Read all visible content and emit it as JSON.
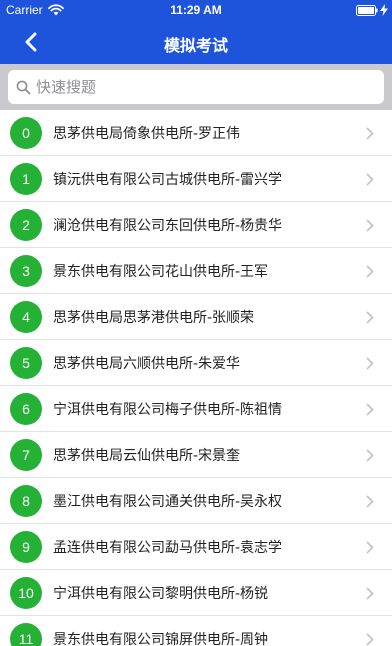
{
  "status_bar": {
    "carrier": "Carrier",
    "time": "11:29 AM"
  },
  "nav": {
    "title": "模拟考试",
    "back_icon": "chevron-left-icon"
  },
  "search": {
    "placeholder": "快速搜题",
    "value": ""
  },
  "colors": {
    "header": "#1e54dc",
    "badge": "#25b136",
    "search_bg": "#c9c9ce"
  },
  "items": [
    {
      "index": "0",
      "label": "思茅供电局倚象供电所-罗正伟"
    },
    {
      "index": "1",
      "label": "镇沅供电有限公司古城供电所-雷兴学"
    },
    {
      "index": "2",
      "label": "澜沧供电有限公司东回供电所-杨贵华"
    },
    {
      "index": "3",
      "label": "景东供电有限公司花山供电所-王军"
    },
    {
      "index": "4",
      "label": "思茅供电局思茅港供电所-张顺荣"
    },
    {
      "index": "5",
      "label": "思茅供电局六顺供电所-朱爱华"
    },
    {
      "index": "6",
      "label": "宁洱供电有限公司梅子供电所-陈祖情"
    },
    {
      "index": "7",
      "label": "思茅供电局云仙供电所-宋景奎"
    },
    {
      "index": "8",
      "label": "墨江供电有限公司通关供电所-吴永权"
    },
    {
      "index": "9",
      "label": "孟连供电有限公司勐马供电所-袁志学"
    },
    {
      "index": "10",
      "label": "宁洱供电有限公司黎明供电所-杨锐"
    },
    {
      "index": "11",
      "label": "景东供电有限公司锦屏供电所-周钟"
    }
  ]
}
